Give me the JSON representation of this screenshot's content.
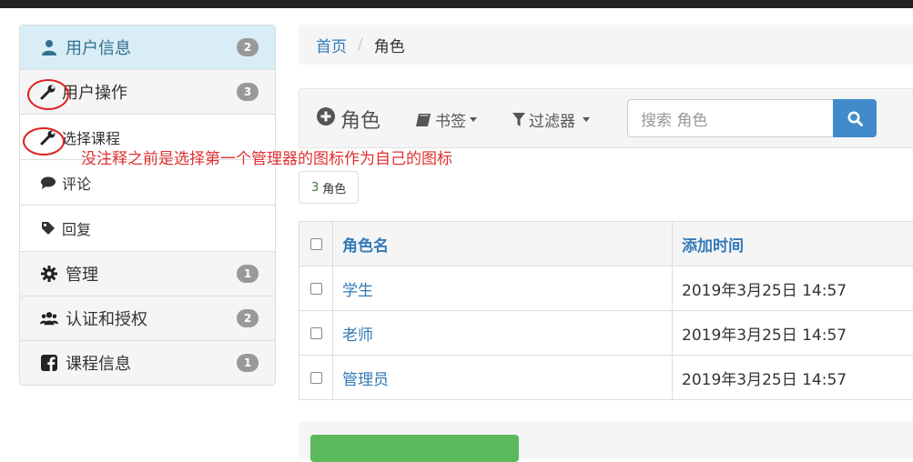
{
  "sidebar": {
    "items": [
      {
        "label": "用户信息",
        "badge": "2",
        "icon": "user-icon"
      },
      {
        "label": "用户操作",
        "badge": "3",
        "icon": "wrench-icon"
      },
      {
        "label": "选择课程",
        "icon": "wrench-icon"
      },
      {
        "label": "评论",
        "icon": "comment-icon"
      },
      {
        "label": "回复",
        "icon": "tag-icon"
      },
      {
        "label": "管理",
        "badge": "1",
        "icon": "gear-icon"
      },
      {
        "label": "认证和授权",
        "badge": "2",
        "icon": "users-icon"
      },
      {
        "label": "课程信息",
        "badge": "1",
        "icon": "facebook-icon"
      }
    ]
  },
  "annotation": "没注释之前是选择第一个管理器的图标作为自己的图标",
  "breadcrumb": {
    "home": "首页",
    "separator": "/",
    "current": "角色"
  },
  "toolbar": {
    "title": "角色",
    "bookmarks": "书签",
    "filters": "过滤器",
    "search_placeholder": "搜索 角色"
  },
  "count": {
    "number": "3",
    "label": "角色"
  },
  "table": {
    "headers": [
      "角色名",
      "添加时间"
    ],
    "rows": [
      {
        "name": "学生",
        "time": "2019年3月25日 14:57"
      },
      {
        "name": "老师",
        "time": "2019年3月25日 14:57"
      },
      {
        "name": "管理员",
        "time": "2019年3月25日 14:57"
      }
    ]
  },
  "colors": {
    "accent": "#337ab7",
    "active_bg": "#d9edf7",
    "annotation": "#e03030",
    "primary_btn": "#428bca",
    "success": "#5cb85c"
  }
}
